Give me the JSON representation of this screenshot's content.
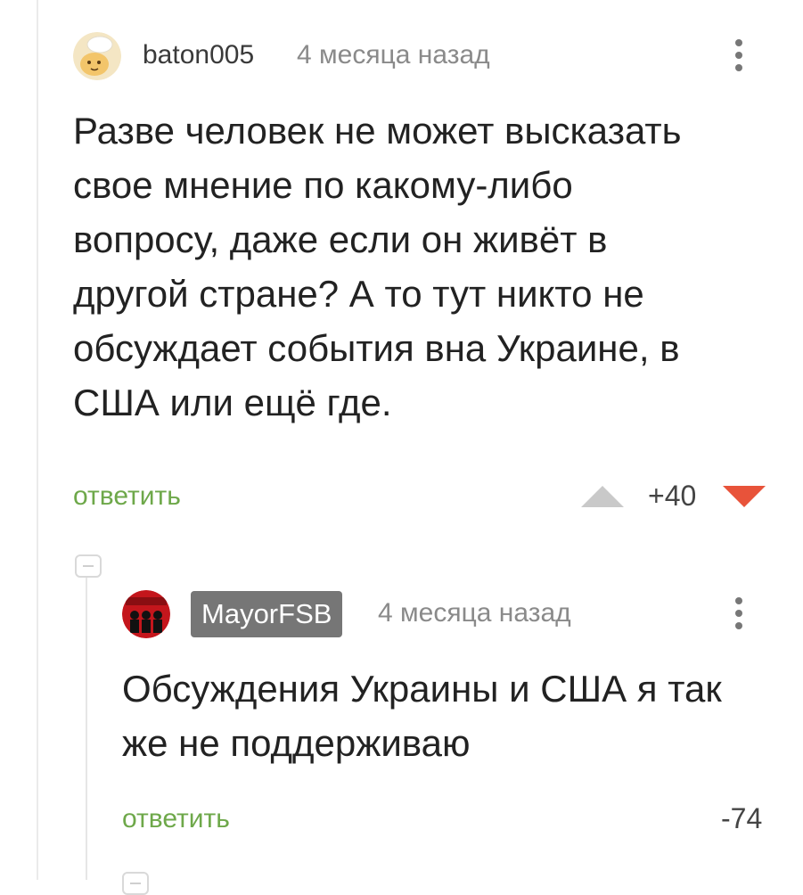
{
  "comments": [
    {
      "username": "baton005",
      "timestamp": "4 месяца назад",
      "text_lines": [
        "Разве человек не может высказать",
        "свое мнение по какому-либо",
        "вопросу, даже если он живёт в",
        "другой стране? А то тут никто не",
        "обсуждает события вна Украине, в",
        "США или ещё где."
      ],
      "reply_label": "ответить",
      "rating": "+40"
    },
    {
      "username": "MayorFSB",
      "timestamp": "4 месяца назад",
      "text_lines": [
        "Обсуждения Украины и США я так",
        "же не поддерживаю"
      ],
      "reply_label": "ответить",
      "rating": "-74"
    }
  ],
  "colors": {
    "upvote": "#c9c9c9",
    "downvote": "#e8533a",
    "reply_link": "#6ea84a",
    "badge_bg": "#767676"
  }
}
